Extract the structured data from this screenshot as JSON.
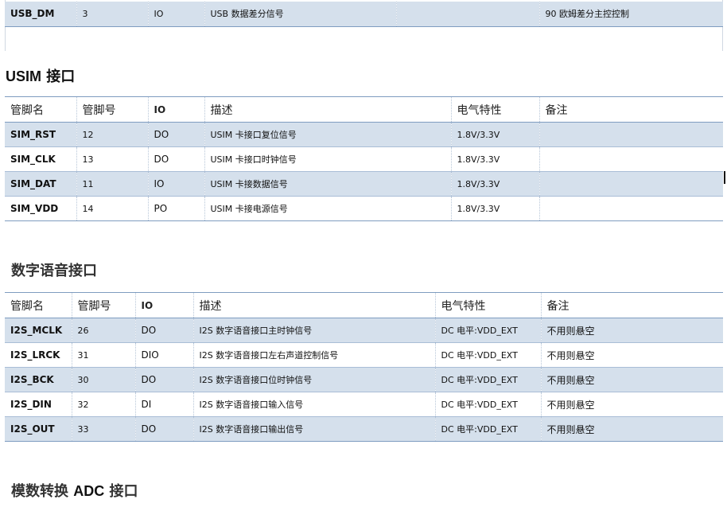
{
  "top_table": {
    "rows": [
      [
        "USB_DM",
        "3",
        "IO",
        "USB 数据差分信号",
        "",
        "90 欧姆差分主控控制"
      ]
    ]
  },
  "usim": {
    "heading_bold": "USIM",
    "heading_rest": " 接口",
    "header": [
      "管脚名",
      "管脚号",
      "IO",
      "描述",
      "电气特性",
      "备注"
    ],
    "rows": [
      [
        "SIM_RST",
        "12",
        "DO",
        "USIM 卡接口复位信号",
        "1.8V/3.3V",
        ""
      ],
      [
        "SIM_CLK",
        "13",
        "DO",
        "USIM 卡接口时钟信号",
        "1.8V/3.3V",
        ""
      ],
      [
        "SIM_DAT",
        "11",
        "IO",
        "USIM 卡接数据信号",
        "1.8V/3.3V",
        ""
      ],
      [
        "SIM_VDD",
        "14",
        "PO",
        "USIM 卡接电源信号",
        "1.8V/3.3V",
        ""
      ]
    ]
  },
  "voice": {
    "heading": "数字语音接口",
    "header": [
      "管脚名",
      "管脚号",
      "IO",
      "描述",
      "电气特性",
      "备注"
    ],
    "rows": [
      [
        "I2S_MCLK",
        "26",
        "DO",
        "I2S 数字语音接口主时钟信号",
        "DC 电平:VDD_EXT",
        "不用则悬空"
      ],
      [
        "I2S_LRCK",
        "31",
        "DIO",
        "I2S 数字语音接口左右声道控制信号",
        "DC 电平:VDD_EXT",
        "不用则悬空"
      ],
      [
        "I2S_BCK",
        "30",
        "DO",
        "I2S 数字语音接口位时钟信号",
        "DC 电平:VDD_EXT",
        "不用则悬空"
      ],
      [
        "I2S_DIN",
        "32",
        "DI",
        "I2S 数字语音接口输入信号",
        "DC 电平:VDD_EXT",
        "不用则悬空"
      ],
      [
        "I2S_OUT",
        "33",
        "DO",
        "I2S 数字语音接口输出信号",
        "DC 电平:VDD_EXT",
        "不用则悬空"
      ]
    ]
  },
  "adc": {
    "heading_pre": "模数转换 ",
    "heading_bold": "ADC",
    "heading_post": " 接口"
  }
}
